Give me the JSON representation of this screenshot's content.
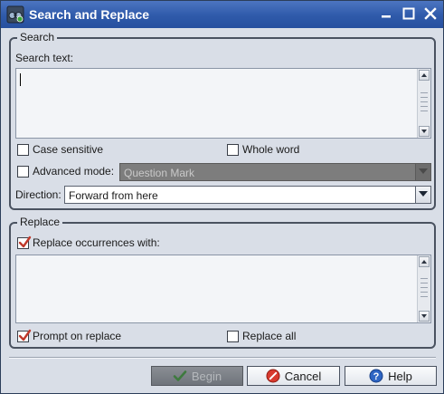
{
  "window": {
    "title": "Search and Replace",
    "controls": [
      "minimize-icon",
      "maximize-icon",
      "close-icon"
    ]
  },
  "search_group": {
    "legend": "Search",
    "search_text_label": "Search text:",
    "search_text_value": "",
    "case_sensitive": {
      "label": "Case sensitive",
      "checked": false
    },
    "whole_word": {
      "label": "Whole word",
      "checked": false
    },
    "advanced_mode": {
      "label": "Advanced mode:",
      "checked": false,
      "selected": "Question Mark",
      "enabled": false
    },
    "direction": {
      "label": "Direction:",
      "selected": "Forward from here"
    }
  },
  "replace_group": {
    "legend": "Replace",
    "replace_occurrences": {
      "label": "Replace occurrences with:",
      "checked": true
    },
    "replace_text_value": "",
    "prompt_on_replace": {
      "label": "Prompt on replace",
      "checked": true
    },
    "replace_all": {
      "label": "Replace all",
      "checked": false
    }
  },
  "buttons": {
    "begin": {
      "label": "Begin",
      "icon": "checkmark-icon",
      "enabled": false
    },
    "cancel": {
      "label": "Cancel",
      "icon": "cancel-icon",
      "enabled": true
    },
    "help": {
      "label": "Help",
      "icon": "help-icon",
      "enabled": true
    }
  },
  "colors": {
    "titlebar": "#2f5aaa",
    "dialog_bg": "#d9dee7",
    "check_mark": "#c0392b",
    "disabled_combo": "#7d7d7d"
  }
}
